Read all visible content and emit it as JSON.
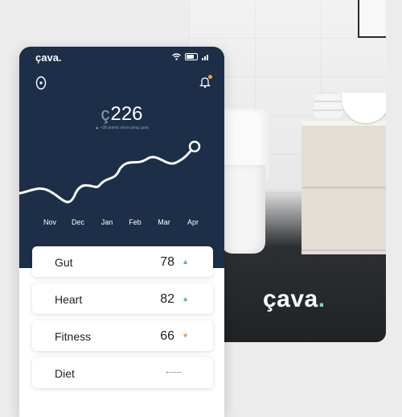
{
  "photo": {
    "brand_text": "çava",
    "brand_dot": "."
  },
  "phone": {
    "status_brand": "çava.",
    "status_icons": [
      "wifi-icon",
      "battery-icon",
      "signal-icon"
    ],
    "top_icons": [
      "home-sensor-icon",
      "notification-bell-icon"
    ],
    "score_prefix": "ç",
    "score_value": "226",
    "score_note_arrow": "▲",
    "score_note": "+38 points since joing çava",
    "months": [
      "Nov",
      "Dec",
      "Jan",
      "Feb",
      "Mar",
      "Apr"
    ],
    "metrics": [
      {
        "name": "Gut",
        "value": "78",
        "trend": "▲",
        "trend_dir": "up"
      },
      {
        "name": "Heart",
        "value": "82",
        "trend": "▲",
        "trend_dir": "up"
      },
      {
        "name": "Fitness",
        "value": "66",
        "trend": "▼",
        "trend_dir": "down"
      },
      {
        "name": "Diet",
        "value": "",
        "trend": "",
        "trend_dir": "none"
      }
    ]
  },
  "colors": {
    "navy": "#1c2e48",
    "accent_up": "#3ec8a0",
    "accent_down": "#f0a43a",
    "brand_dot": "#7ad7b5"
  }
}
